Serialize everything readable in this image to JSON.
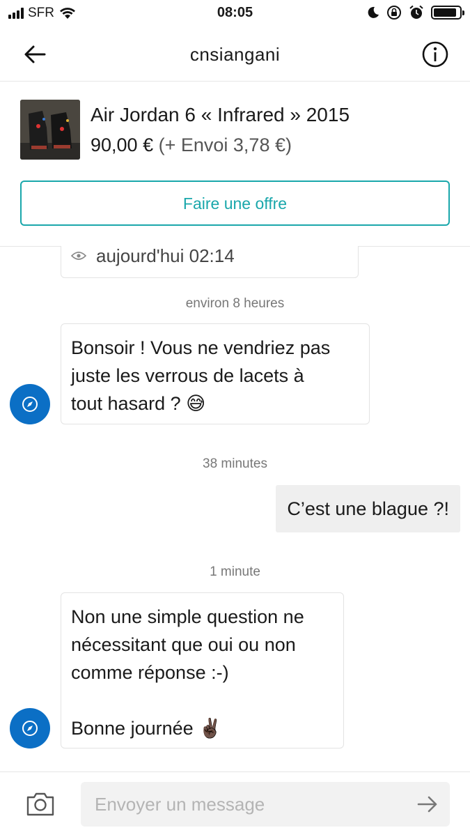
{
  "status_bar": {
    "carrier": "SFR",
    "time": "08:05"
  },
  "header": {
    "title": "cnsiangani",
    "back_icon": "arrow-left-icon",
    "info_icon": "info-circle-icon"
  },
  "product": {
    "title": "Air Jordan 6 « Infrared » 2015",
    "price": "90,00 €",
    "shipping": "(+ Envoi 3,78 €)",
    "offer_button": "Faire une offre"
  },
  "chat": {
    "seen_text": "aujourd'hui 02:14",
    "messages": [
      {
        "time": "environ 8 heures",
        "from": "other",
        "lines": [
          "Bonsoir ! Vous ne vendriez pas",
          "juste les verrous de lacets à",
          "tout hasard ?"
        ],
        "emoji": "😅"
      },
      {
        "time": "38 minutes",
        "from": "me",
        "text": "C’est une blague ?!"
      },
      {
        "time": "1 minute",
        "from": "other",
        "lines": [
          "Non une simple question ne",
          "nécessitant que oui ou non",
          "comme réponse :-)",
          "",
          "Bonne journée"
        ],
        "emoji": "✌🏿"
      }
    ]
  },
  "composer": {
    "placeholder": "Envoyer un message",
    "camera_icon": "camera-icon",
    "send_icon": "send-arrow-icon"
  },
  "colors": {
    "accent": "#1aa7ab",
    "avatar": "#0b6fc5",
    "my_bubble": "#efefef"
  }
}
